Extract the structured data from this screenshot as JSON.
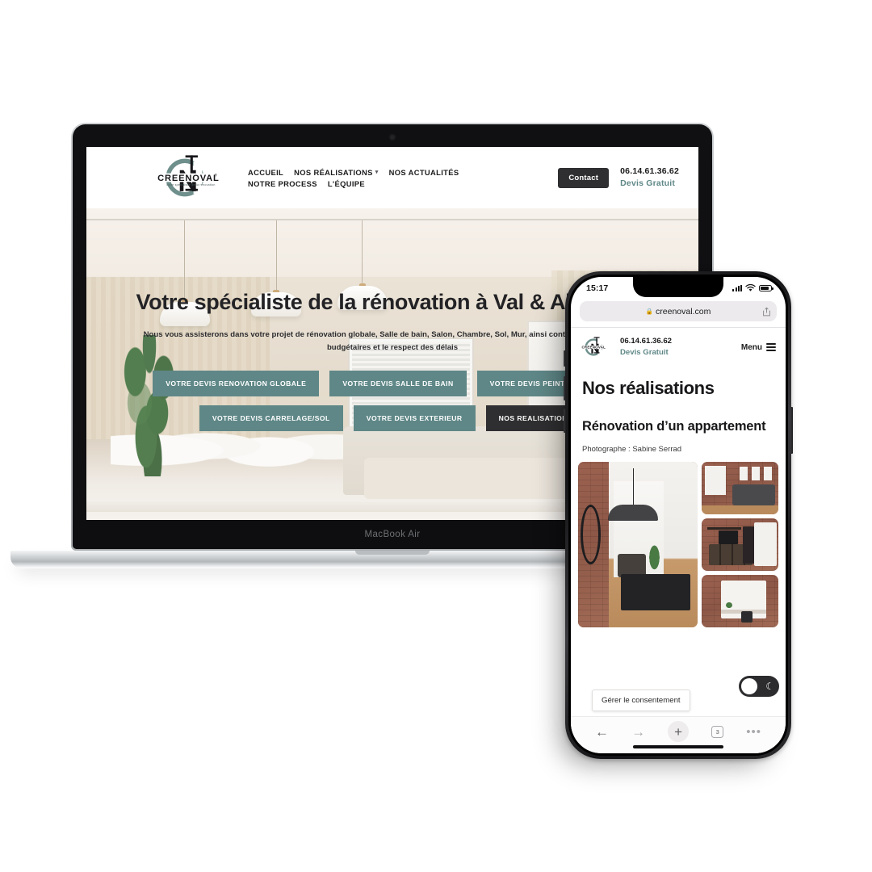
{
  "laptop": {
    "model_label": "MacBook Air",
    "site": {
      "brand": {
        "wordmark": "CREENOVAL",
        "registered": "®",
        "tagline": "Votre spécialiste de la rénovation",
        "accent_color": "#5f8787"
      },
      "nav": [
        {
          "label": "ACCUEIL",
          "has_caret": false
        },
        {
          "label": "NOS RÉALISATIONS",
          "has_caret": true
        },
        {
          "label": "NOS ACTUALITÉS",
          "has_caret": false
        },
        {
          "label": "NOTRE PROCESS",
          "has_caret": false
        },
        {
          "label": "L'ÉQUIPE",
          "has_caret": false
        }
      ],
      "header_right": {
        "contact_label": "Contact",
        "phone": "06.14.61.36.62",
        "quote_label": "Devis Gratuit"
      },
      "hero": {
        "title": "Votre spécialiste de la rénovation à Val & Alentours",
        "subtitle": "Nous vous assisterons dans votre projet de rénovation globale, Salle de bain, Salon, Chambre, Sol, Mur, ainsi contraintes structurelles, budgétaires et le respect des délais",
        "cta_row_1": [
          "VOTRE DEVIS RENOVATION GLOBALE",
          "VOTRE DEVIS SALLE DE BAIN",
          "VOTRE DEVIS PEINTURE/PLAFOND"
        ],
        "cta_row_2": [
          "VOTRE DEVIS CARRELAGE/SOL",
          "VOTRE DEVIS EXTERIEUR"
        ],
        "cta_dark": "NOS REALISATIONS"
      }
    }
  },
  "phone": {
    "status": {
      "time": "15:17"
    },
    "browser": {
      "url": "creenoval.com",
      "lock_icon": "lock-icon",
      "share_icon": "share-icon",
      "tab_count": "3",
      "back_icon": "back-arrow-icon",
      "forward_icon": "forward-arrow-icon",
      "new_tab_icon": "plus-icon",
      "more_icon": "more-dots-icon"
    },
    "site": {
      "phone": "06.14.61.36.62",
      "quote_label": "Devis Gratuit",
      "menu_label": "Menu",
      "page_title": "Nos réalisations",
      "project_title": "Rénovation d’un appartement",
      "credit": "Photographe : Sabine Serrad",
      "gallery": [
        {
          "name": "hallway-photo"
        },
        {
          "name": "living-room-photo"
        },
        {
          "name": "tv-unit-photo"
        },
        {
          "name": "kitchen-photo"
        }
      ],
      "consent_label": "Gérer le consentement",
      "dark_mode_icon": "moon-icon"
    }
  }
}
